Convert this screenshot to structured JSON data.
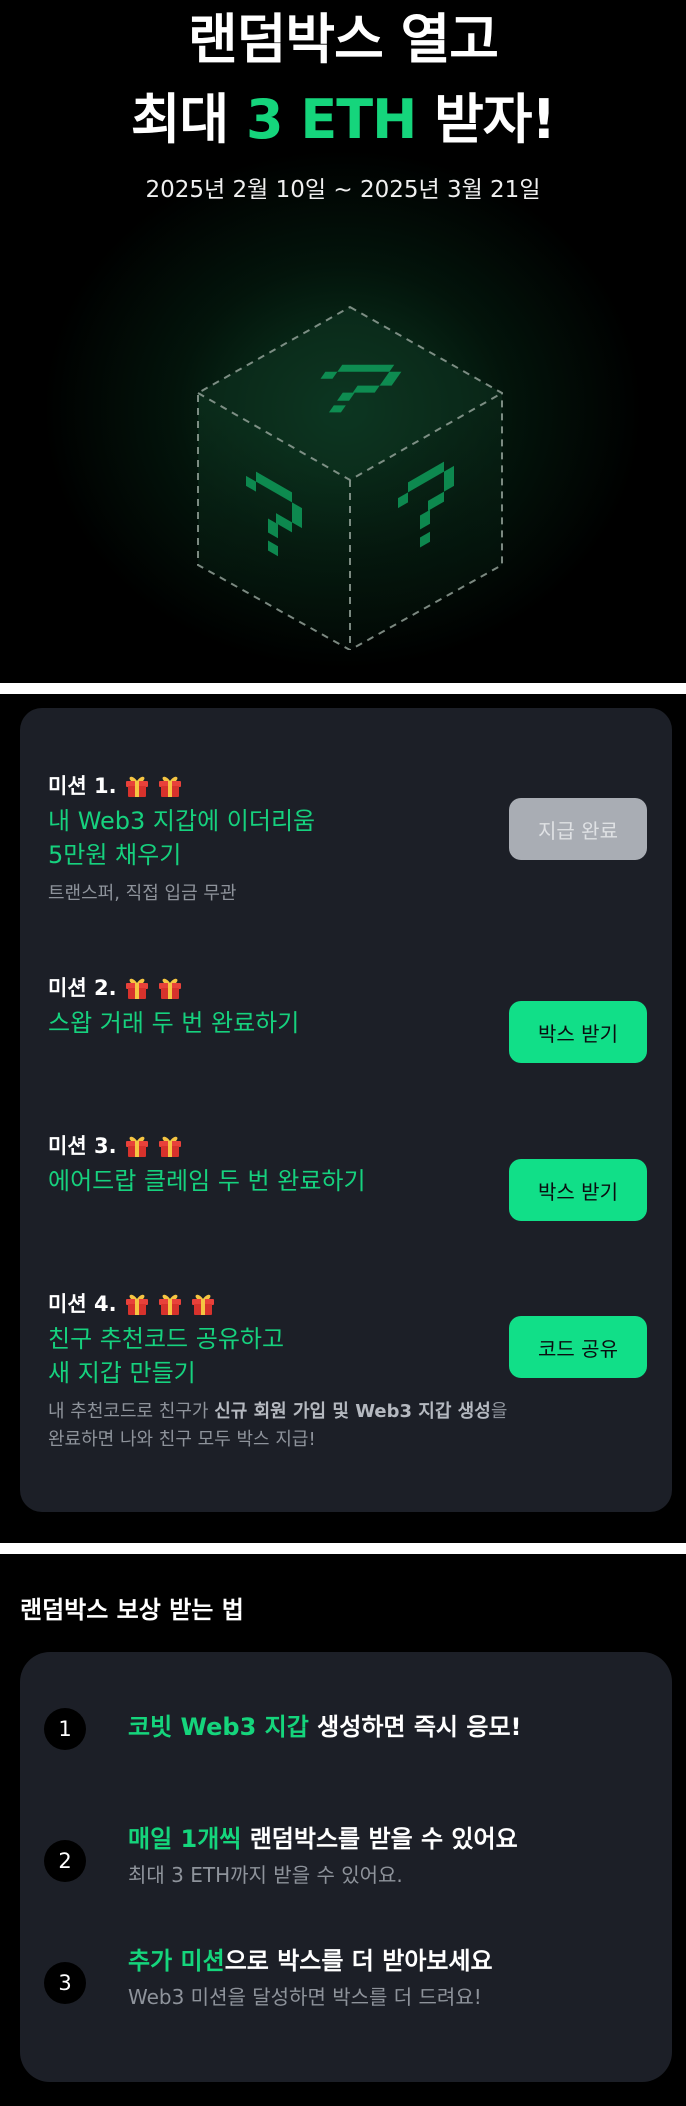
{
  "hero": {
    "title_line1": "랜덤박스 열고",
    "title_line2_pre": "최대 ",
    "title_line2_highlight": "3 ETH",
    "title_line2_post": " 받자!",
    "date_range": "2025년 2월 10일 ~ 2025년 3월 21일"
  },
  "missions": [
    {
      "label": "미션 1.",
      "gift_count": 2,
      "title": "내 Web3 지갑에 이더리움\n5만원 채우기",
      "desc": "트랜스퍼, 직접 입금 무관",
      "button": "지급 완료",
      "button_state": "disabled"
    },
    {
      "label": "미션 2.",
      "gift_count": 2,
      "title": "스왑 거래 두 번 완료하기",
      "button": "박스 받기",
      "button_state": "active"
    },
    {
      "label": "미션 3.",
      "gift_count": 2,
      "title": "에어드랍 클레임 두 번 완료하기",
      "button": "박스 받기",
      "button_state": "active"
    },
    {
      "label": "미션 4.",
      "gift_count": 3,
      "title": "친구 추천코드 공유하고\n새 지갑 만들기",
      "desc_pre": "내 추천코드로 친구가 ",
      "desc_bold": "신규 회원 가입 및 Web3 지갑 생성",
      "desc_post": "을 완료하면 나와 친구 모두 박스 지급!",
      "button": "코드 공유",
      "button_state": "active"
    }
  ],
  "how": {
    "title": "랜덤박스 보상 받는 법",
    "steps": [
      {
        "num": "1",
        "highlight": "코빗 Web3 지갑",
        "rest": " 생성하면 즉시 응모!"
      },
      {
        "num": "2",
        "highlight": "매일 1개씩",
        "rest": " 랜덤박스를 받을 수 있어요",
        "sub": "최대 3 ETH까지 받을 수 있어요."
      },
      {
        "num": "3",
        "highlight": "추가 미션",
        "rest": "으로 박스를 더 받아보세요",
        "sub": "Web3 미션을 달성하면 박스를 더 드려요!"
      }
    ]
  },
  "colors": {
    "accent": "#16d17e",
    "button": "#11df88",
    "card": "#1c1f27",
    "disabled": "#a9adb4"
  },
  "icons": {
    "gift": "gift-icon",
    "box": "mystery-box-icon"
  }
}
